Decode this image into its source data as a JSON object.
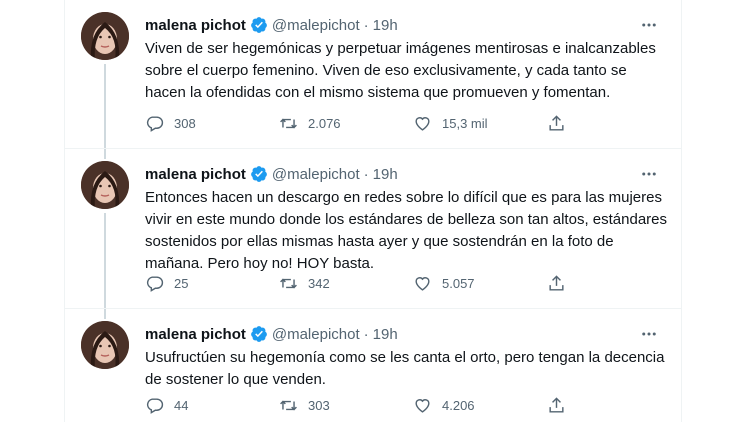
{
  "tweets": [
    {
      "name": "malena pichot",
      "handle": "@malepichot",
      "time": "19h",
      "text": "Viven de ser hegemónicas y perpetuar imágenes mentirosas e inalcanzables sobre el cuerpo femenino. Viven de eso exclusivamente, y cada tanto se hacen la ofendidas con el mismo sistema que promueven y fomentan.",
      "replies": "308",
      "retweets": "2.076",
      "likes": "15,3 mil"
    },
    {
      "name": "malena pichot",
      "handle": "@malepichot",
      "time": "19h",
      "text": "Entonces hacen un descargo en redes sobre lo difícil que es para las mujeres vivir en este mundo donde los estándares de belleza son tan altos, estándares sostenidos por ellas mismas hasta ayer y que sostendrán en la foto de mañana. Pero hoy no! HOY basta.",
      "replies": "25",
      "retweets": "342",
      "likes": "5.057"
    },
    {
      "name": "malena pichot",
      "handle": "@malepichot",
      "time": "19h",
      "text": "Usufructúen su hegemonía como se les canta el orto, pero tengan la decencia de sostener lo que venden.",
      "replies": "44",
      "retweets": "303",
      "likes": "4.206"
    }
  ],
  "separator": "·",
  "colors": {
    "text": "#0f1419",
    "muted": "#536471",
    "verified": "#1d9bf0",
    "thread_line": "#cfd9de",
    "border": "#eff3f4"
  },
  "icons": [
    "verified-badge-icon",
    "more-icon",
    "reply-icon",
    "retweet-icon",
    "like-icon",
    "share-icon"
  ]
}
